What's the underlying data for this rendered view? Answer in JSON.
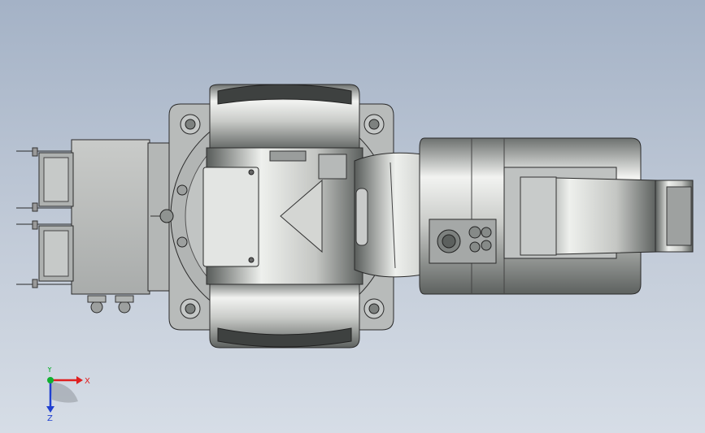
{
  "viewport": {
    "background_top": "#a4b2c6",
    "background_bottom": "#d6dde6"
  },
  "model": {
    "name": "robot-arm-top-view",
    "body_color": "#b9bcbc",
    "edge_color": "#2a2a2a"
  },
  "triad": {
    "x_label": "X",
    "y_label": "Y",
    "z_label": "Z",
    "x_color": "#e02020",
    "y_color": "#10b030",
    "z_color": "#2040d0"
  }
}
